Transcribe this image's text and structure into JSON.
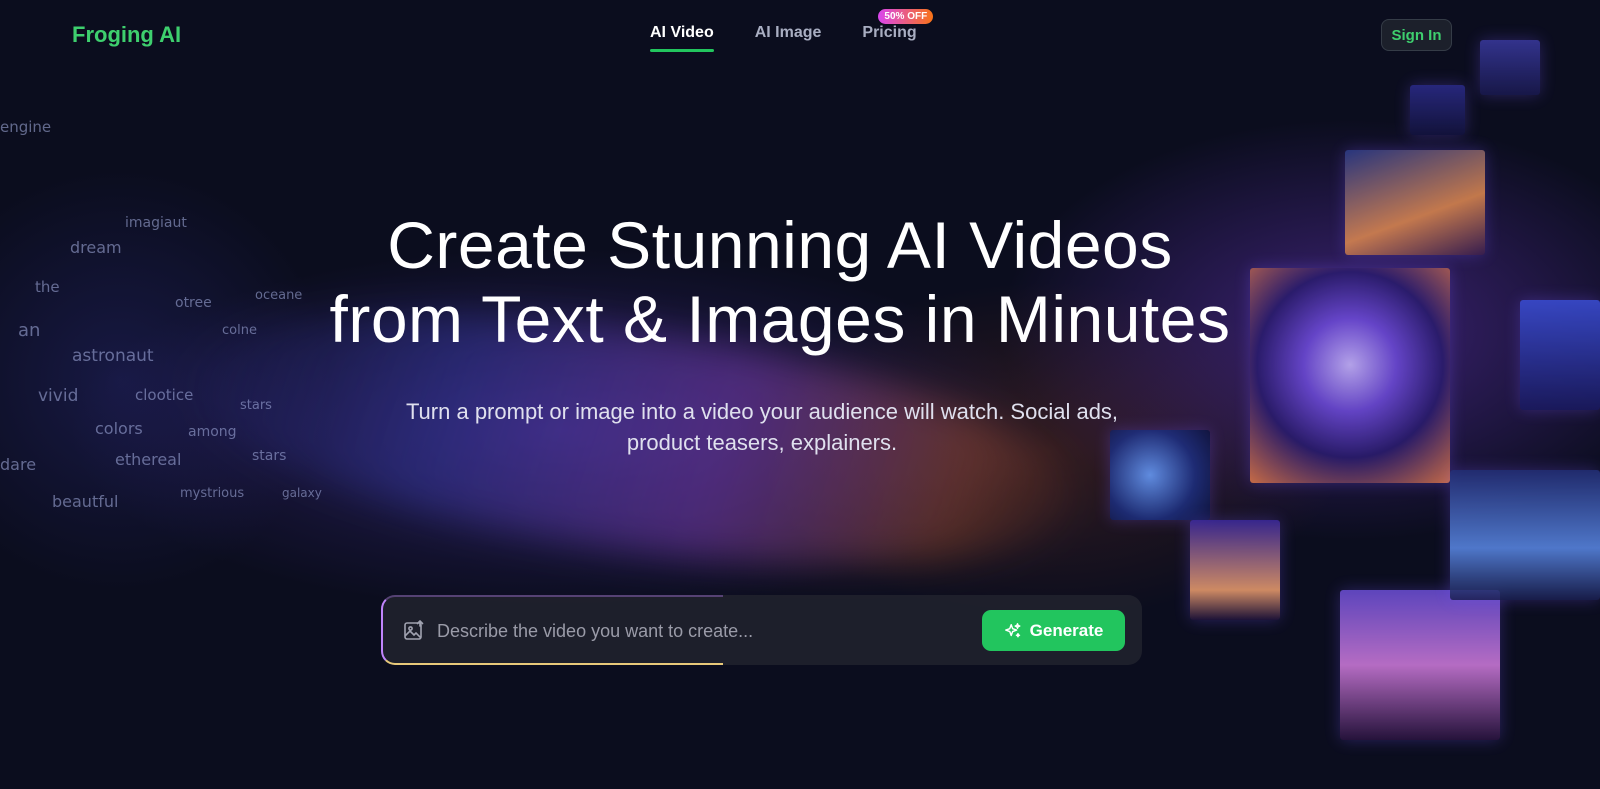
{
  "header": {
    "logo": "Froging AI",
    "nav": [
      {
        "label": "AI Video",
        "active": true
      },
      {
        "label": "AI Image",
        "active": false
      },
      {
        "label": "Pricing",
        "active": false,
        "badge": "50% OFF"
      }
    ],
    "signin_label": "Sign In"
  },
  "hero": {
    "title_line1": "Create Stunning AI Videos",
    "title_line2": "from Text & Images in Minutes",
    "subtitle_line1": "Turn a prompt or image into a video your audience will watch. Social ads,",
    "subtitle_line2": "product teasers, explainers."
  },
  "prompt": {
    "placeholder": "Describe the video you want to create...",
    "value": "",
    "upload_icon": "image-upload-icon",
    "generate_label": "Generate",
    "generate_icon": "sparkles-icon"
  },
  "colors": {
    "brand": "#3ecf6e",
    "button": "#22c55e",
    "background": "#0b0d1e",
    "badge_from": "#d946ef",
    "badge_to": "#f97316"
  },
  "background_words": [
    "engine",
    "imagiaut",
    "dream",
    "the",
    "otree",
    "oceane",
    "an",
    "astronaut",
    "colne",
    "vivid",
    "clootice",
    "stars",
    "colors",
    "among",
    "ethereal",
    "stars",
    "beautful",
    "mystrious",
    "galaxy",
    "dare"
  ]
}
